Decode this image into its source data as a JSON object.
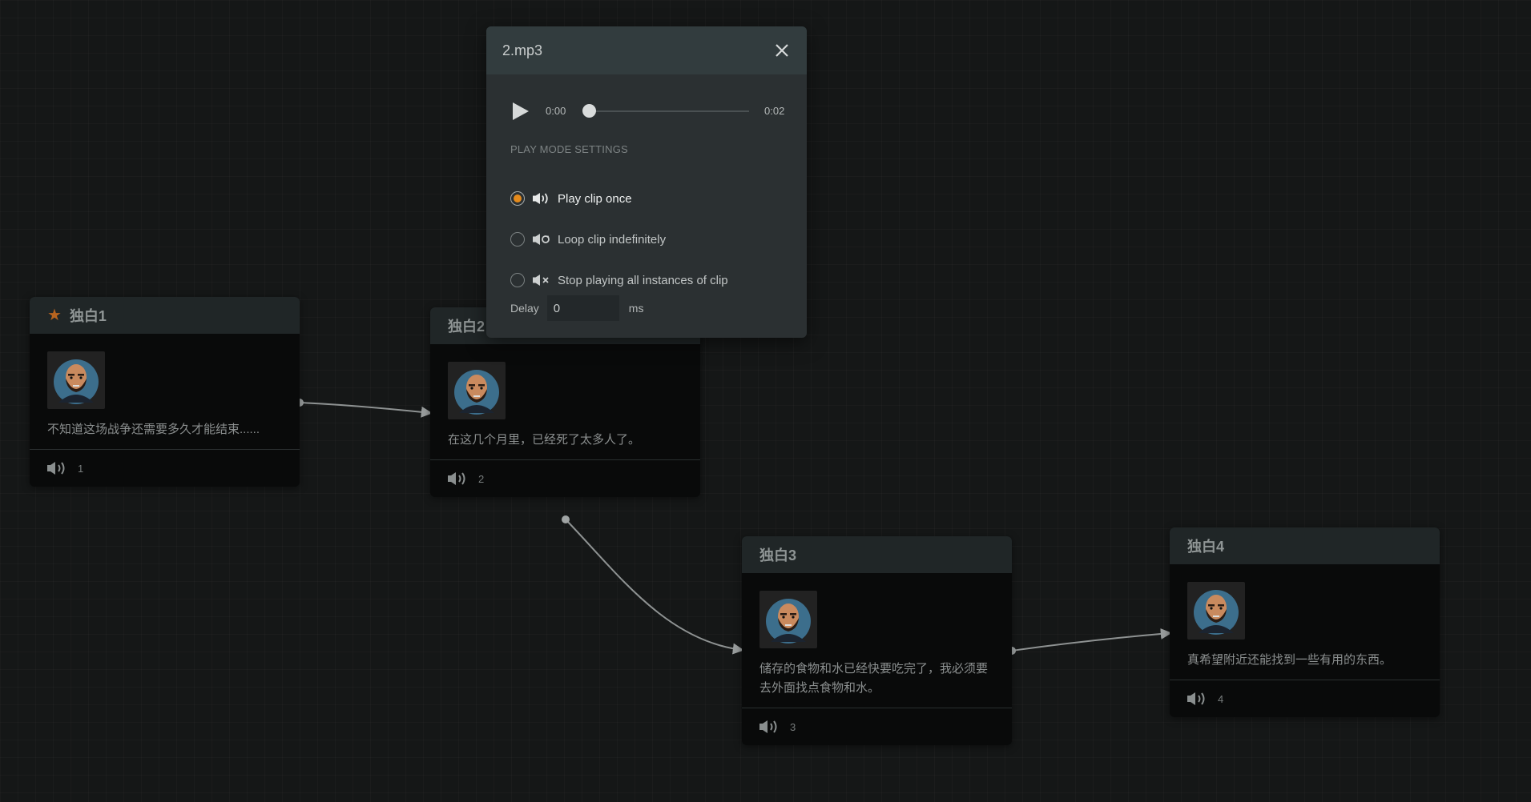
{
  "colors": {
    "accent_orange": "#e48a1c",
    "star_orange": "#b8641f",
    "node_header": "#202627",
    "node_body": "#090a0a",
    "popup_bg": "#2b3032",
    "popup_header": "#323c3e"
  },
  "nodes": [
    {
      "title": "独白1",
      "starred": true,
      "text": "不知道这场战争还需要多久才能结束......",
      "clip": "1",
      "icon": "speaker-icon"
    },
    {
      "title": "独白2",
      "starred": false,
      "text": "在这几个月里，已经死了太多人了。",
      "clip": "2",
      "icon": "speaker-icon"
    },
    {
      "title": "独白3",
      "starred": false,
      "text": "储存的食物和水已经快要吃完了，我必须要去外面找点食物和水。",
      "clip": "3",
      "icon": "speaker-icon"
    },
    {
      "title": "独白4",
      "starred": false,
      "text": "真希望附近还能找到一些有用的东西。",
      "clip": "4",
      "icon": "speaker-icon"
    }
  ],
  "popup": {
    "title": "2.mp3",
    "player": {
      "current_time": "0:00",
      "total_time": "0:02",
      "progress": 0.0
    },
    "section_label": "PLAY MODE SETTINGS",
    "modes": [
      {
        "label": "Play clip once",
        "selected": true,
        "icon": "speaker-play-icon"
      },
      {
        "label": "Loop clip indefinitely",
        "selected": false,
        "icon": "speaker-loop-icon"
      },
      {
        "label": "Stop playing all instances of clip",
        "selected": false,
        "icon": "speaker-mute-icon"
      }
    ],
    "delay": {
      "label": "Delay",
      "value": "0",
      "unit": "ms"
    }
  }
}
